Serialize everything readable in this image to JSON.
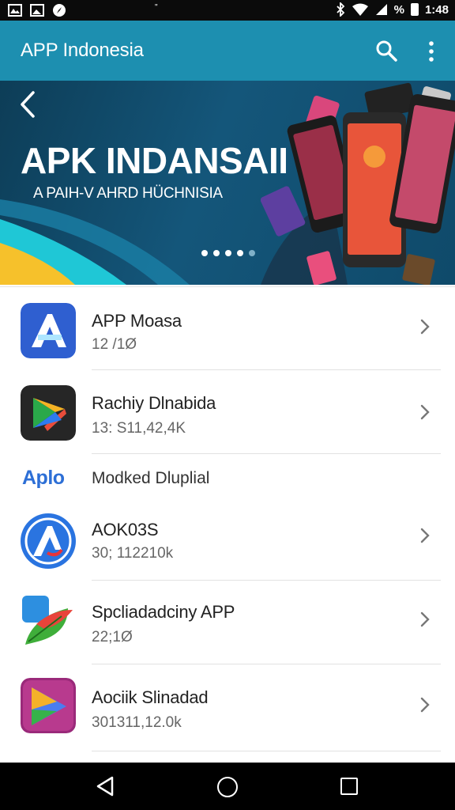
{
  "status_bar": {
    "left_icons": [
      "gallery-icon",
      "image-icon",
      "compass-icon"
    ],
    "center_text": "\"",
    "right_icons": [
      "bluetooth-icon",
      "wifi-icon",
      "signal-icon",
      "battery-icon"
    ],
    "battery_percent": "%",
    "time": "1:48"
  },
  "app_bar": {
    "title": "APP Indonesia",
    "search_icon": "search-icon",
    "more_icon": "more-vert-icon",
    "color": "#1d8fb0"
  },
  "banner": {
    "title": "APK INDANSAII",
    "subtitle": "A PAIH-V AHRD HÜCHNISIA",
    "active_slide": 1,
    "slide_count": 5
  },
  "list": {
    "items": [
      {
        "name": "APP Moasa",
        "meta": "12 /1Ø"
      },
      {
        "name": "Rachiy Dlnabida",
        "meta": "13: S11,42,4K"
      },
      {
        "name": "AOK03S",
        "meta": "30; 112210k"
      },
      {
        "name": "Spcliadadciny APP",
        "meta": "22;1Ø"
      },
      {
        "name": "Aociik Slinadad",
        "meta": "301311,12.0k"
      }
    ],
    "section": {
      "logo_text": "Aplo",
      "label": "Modked Dluplial"
    }
  },
  "colors": {
    "accent": "#1d8fb0",
    "banner_dark": "#0d3d57"
  }
}
